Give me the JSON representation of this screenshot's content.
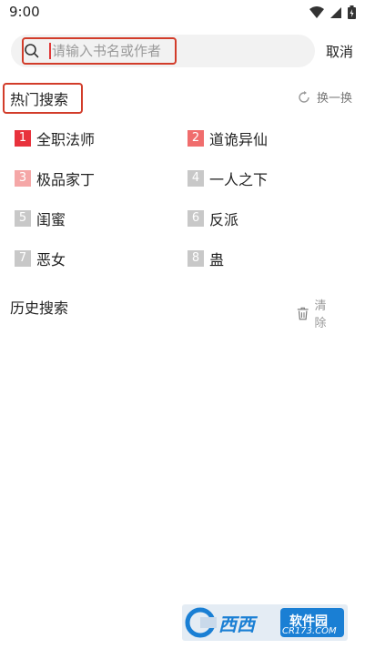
{
  "status_bar": {
    "time": "9:00",
    "icons": [
      "wifi-icon",
      "signal-icon",
      "battery-icon"
    ]
  },
  "search": {
    "placeholder": "请输入书名或作者",
    "value": "",
    "cancel_label": "取消"
  },
  "hot": {
    "title": "热门搜索",
    "refresh_label": "换一换",
    "items": [
      {
        "rank": "1",
        "label": "全职法师",
        "color": "#e8323c"
      },
      {
        "rank": "2",
        "label": "道诡异仙",
        "color": "#f06d6d"
      },
      {
        "rank": "3",
        "label": "极品家丁",
        "color": "#f5a7a7"
      },
      {
        "rank": "4",
        "label": "一人之下",
        "color": "#c8c8c8"
      },
      {
        "rank": "5",
        "label": "闺蜜",
        "color": "#c8c8c8"
      },
      {
        "rank": "6",
        "label": "反派",
        "color": "#c8c8c8"
      },
      {
        "rank": "7",
        "label": "恶女",
        "color": "#c8c8c8"
      },
      {
        "rank": "8",
        "label": "蛊",
        "color": "#c8c8c8"
      }
    ]
  },
  "history": {
    "title": "历史搜索",
    "clear_label": "清除"
  },
  "watermark": {
    "brand": "西西",
    "sub": "软件园",
    "domain": "CR173.COM"
  }
}
